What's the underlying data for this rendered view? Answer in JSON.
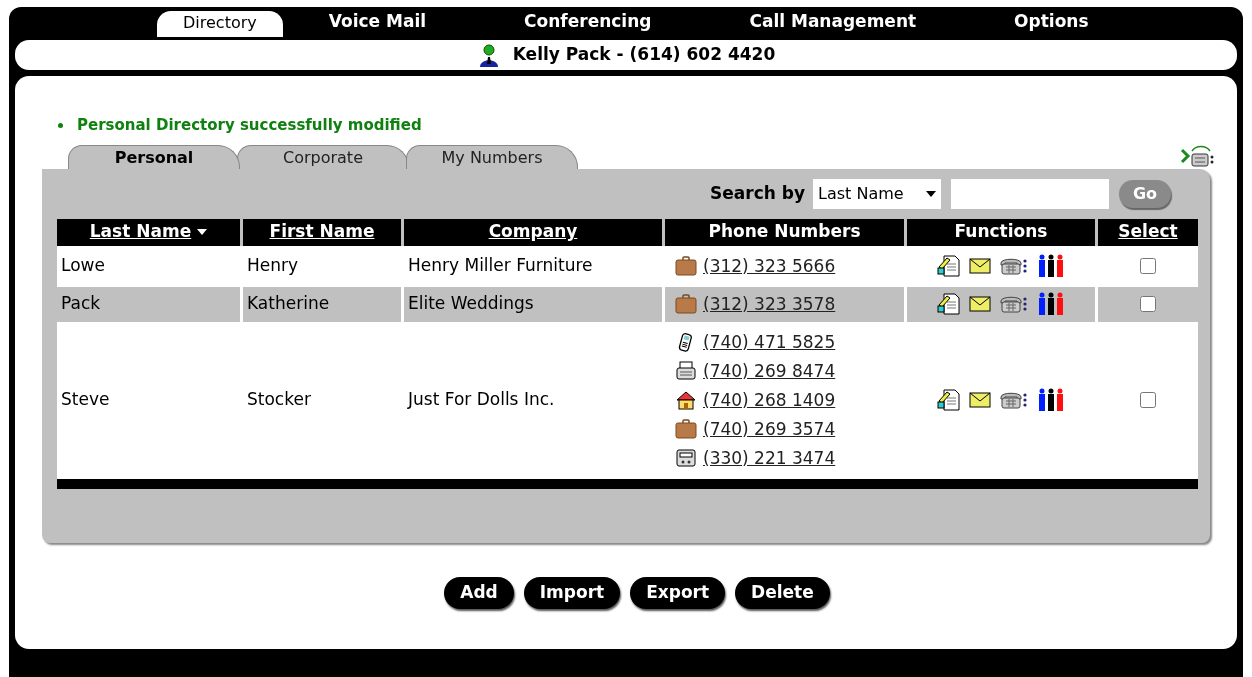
{
  "nav": {
    "tabs": [
      {
        "label": "Directory",
        "selected": true
      },
      {
        "label": "Voice Mail",
        "selected": false
      },
      {
        "label": "Conferencing",
        "selected": false
      },
      {
        "label": "Call Management",
        "selected": false
      },
      {
        "label": "Options",
        "selected": false
      }
    ]
  },
  "user_bar": {
    "name": "Kelly Pack - (614) 602 4420"
  },
  "message": "Personal Directory successfully modified",
  "directory_tabs": [
    {
      "label": "Personal",
      "selected": true
    },
    {
      "label": "Corporate",
      "selected": false
    },
    {
      "label": "My Numbers",
      "selected": false
    }
  ],
  "search": {
    "label": "Search by",
    "field": "Last Name",
    "button": "Go"
  },
  "table": {
    "columns": [
      {
        "label": "Last Name",
        "sortable": true,
        "sorted": true
      },
      {
        "label": "First Name",
        "sortable": true,
        "sorted": false
      },
      {
        "label": "Company",
        "sortable": true,
        "sorted": false
      },
      {
        "label": "Phone Numbers",
        "sortable": false,
        "sorted": false
      },
      {
        "label": "Functions",
        "sortable": false,
        "sorted": false
      },
      {
        "label": "Select",
        "sortable": true,
        "sorted": false
      }
    ],
    "rows": [
      {
        "last_name": "Lowe",
        "first_name": "Henry",
        "company": "Henry Miller Furniture",
        "phones": [
          {
            "kind": "business",
            "number": "(312) 323 5666"
          }
        ],
        "checked": false
      },
      {
        "last_name": "Pack",
        "first_name": "Katherine",
        "company": "Elite Weddings",
        "phones": [
          {
            "kind": "business",
            "number": "(312) 323 3578"
          }
        ],
        "checked": false
      },
      {
        "last_name": "Steve",
        "first_name": "Stocker",
        "company": "Just For Dolls Inc.",
        "phones": [
          {
            "kind": "mobile",
            "number": "(740) 471 5825"
          },
          {
            "kind": "fax",
            "number": "(740) 269 8474"
          },
          {
            "kind": "home",
            "number": "(740) 268 1409"
          },
          {
            "kind": "business",
            "number": "(740) 269 3574"
          },
          {
            "kind": "pager",
            "number": "(330) 221 3474"
          }
        ],
        "checked": false
      }
    ]
  },
  "buttons": [
    "Add",
    "Import",
    "Export",
    "Delete"
  ]
}
